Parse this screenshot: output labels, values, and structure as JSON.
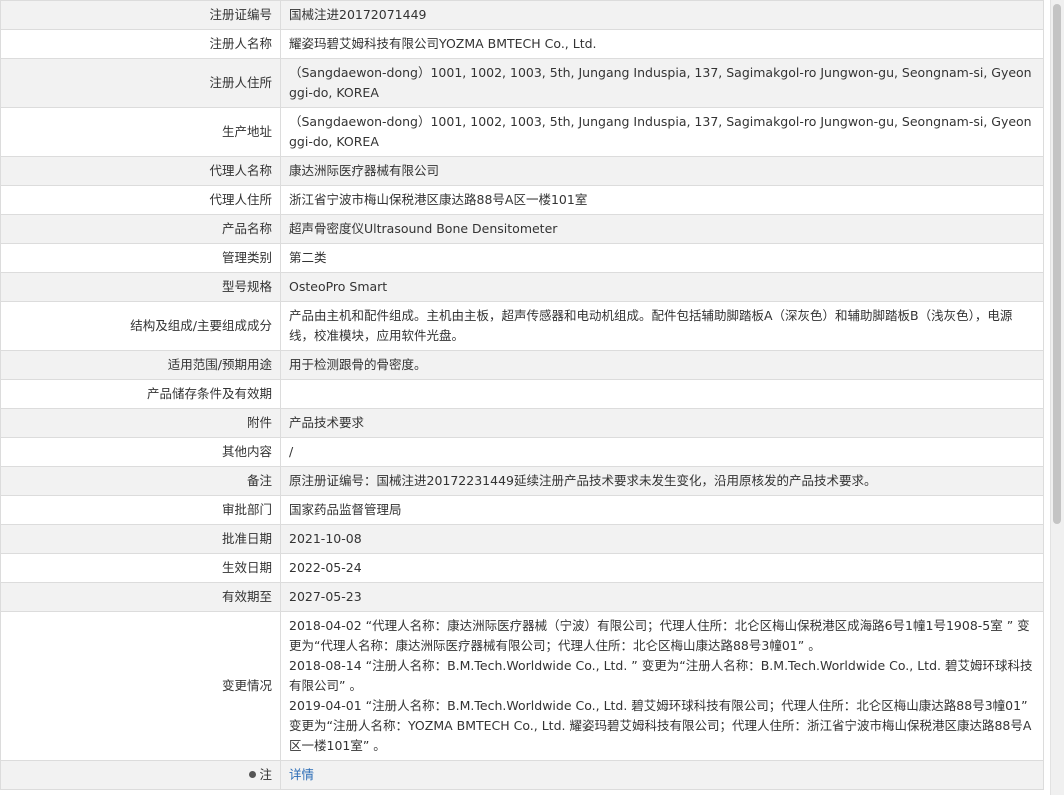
{
  "rows": [
    {
      "label": "注册证编号",
      "value": "国械注进20172071449"
    },
    {
      "label": "注册人名称",
      "value": "耀姿玛碧艾姆科技有限公司YOZMA BMTECH Co., Ltd."
    },
    {
      "label": "注册人住所",
      "value": "（Sangdaewon-dong）1001, 1002, 1003, 5th, Jungang Induspia, 137, Sagimakgol-ro Jungwon-gu, Seongnam-si, Gyeonggi-do, KOREA"
    },
    {
      "label": "生产地址",
      "value": "（Sangdaewon-dong）1001, 1002, 1003, 5th, Jungang Induspia, 137, Sagimakgol-ro Jungwon-gu, Seongnam-si, Gyeonggi-do, KOREA"
    },
    {
      "label": "代理人名称",
      "value": "康达洲际医疗器械有限公司"
    },
    {
      "label": "代理人住所",
      "value": "浙江省宁波市梅山保税港区康达路88号A区一楼101室"
    },
    {
      "label": "产品名称",
      "value": "超声骨密度仪Ultrasound Bone Densitometer"
    },
    {
      "label": "管理类别",
      "value": "第二类"
    },
    {
      "label": "型号规格",
      "value": "OsteoPro Smart"
    },
    {
      "label": "结构及组成/主要组成成分",
      "value": "产品由主机和配件组成。主机由主板，超声传感器和电动机组成。配件包括辅助脚踏板A（深灰色）和辅助脚踏板B（浅灰色），电源线，校准模块，应用软件光盘。"
    },
    {
      "label": "适用范围/预期用途",
      "value": "用于检测跟骨的骨密度。"
    },
    {
      "label": "产品储存条件及有效期",
      "value": ""
    },
    {
      "label": "附件",
      "value": "产品技术要求"
    },
    {
      "label": "其他内容",
      "value": "/"
    },
    {
      "label": "备注",
      "value": "原注册证编号：国械注进20172231449延续注册产品技术要求未发生变化，沿用原核发的产品技术要求。"
    },
    {
      "label": "审批部门",
      "value": "国家药品监督管理局"
    },
    {
      "label": "批准日期",
      "value": "2021-10-08"
    },
    {
      "label": "生效日期",
      "value": "2022-05-24"
    },
    {
      "label": "有效期至",
      "value": "2027-05-23"
    },
    {
      "label": "变更情况",
      "value": "2018-04-02 “代理人名称：康达洲际医疗器械（宁波）有限公司；代理人住所：北仑区梅山保税港区成海路6号1幢1号1908-5室 ” 变更为“代理人名称：康达洲际医疗器械有限公司；代理人住所：北仑区梅山康达路88号3幢01” 。\n2018-08-14 “注册人名称：B.M.Tech.Worldwide Co., Ltd. ” 变更为“注册人名称：B.M.Tech.Worldwide Co., Ltd. 碧艾姆环球科技有限公司” 。\n2019-04-01 “注册人名称：B.M.Tech.Worldwide Co., Ltd. 碧艾姆环球科技有限公司；代理人住所：北仑区梅山康达路88号3幢01” 变更为“注册人名称：YOZMA BMTECH Co., Ltd. 耀姿玛碧艾姆科技有限公司；代理人住所：浙江省宁波市梅山保税港区康达路88号A区一楼101室” 。"
    }
  ],
  "note": {
    "label": "注",
    "link": "详情"
  }
}
